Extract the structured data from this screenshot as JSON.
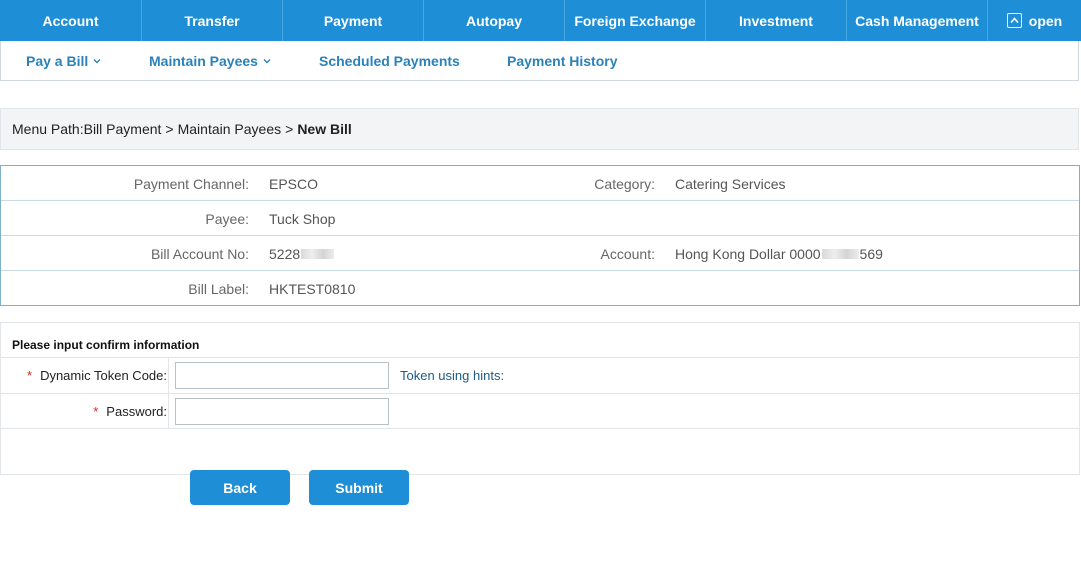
{
  "top_nav": {
    "items": [
      {
        "label": "Account"
      },
      {
        "label": "Transfer"
      },
      {
        "label": "Payment"
      },
      {
        "label": "Autopay"
      },
      {
        "label": "Foreign Exchange"
      },
      {
        "label": "Investment"
      },
      {
        "label": "Cash Management"
      }
    ],
    "open_label": "open",
    "open_icon": "expand-square-icon",
    "background_color": "#1e8fd6"
  },
  "sub_nav": {
    "items": [
      {
        "label": "Pay a Bill",
        "icon": "chevron-down-icon"
      },
      {
        "label": "Maintain Payees",
        "icon": "chevron-down-icon"
      },
      {
        "label": "Scheduled Payments"
      },
      {
        "label": "Payment History"
      }
    ],
    "text_color": "#2a82b9"
  },
  "breadcrumb": {
    "prefix": "Menu Path:",
    "path": [
      "Bill Payment",
      "Maintain Payees"
    ],
    "separator": ">",
    "current": "New Bill"
  },
  "details": {
    "payment_channel_label": "Payment Channel:",
    "payment_channel_value": "EPSCO",
    "category_label": "Category:",
    "category_value": "Catering Services",
    "payee_label": "Payee:",
    "payee_value": "Tuck Shop",
    "bill_account_label": "Bill Account No:",
    "bill_account_prefix": "5228",
    "account_label": "Account:",
    "account_prefix": "Hong Kong Dollar 0000",
    "account_suffix": "569",
    "bill_label_label": "Bill Label:",
    "bill_label_value": "HKTEST0810"
  },
  "confirm": {
    "header": "Please input confirm information",
    "required_mark": "*",
    "token_label": "Dynamic Token Code:",
    "token_value": "",
    "token_hint": "Token using hints:",
    "password_label": "Password:",
    "password_value": ""
  },
  "buttons": {
    "back": "Back",
    "submit": "Submit",
    "color": "#1e8fd6"
  }
}
